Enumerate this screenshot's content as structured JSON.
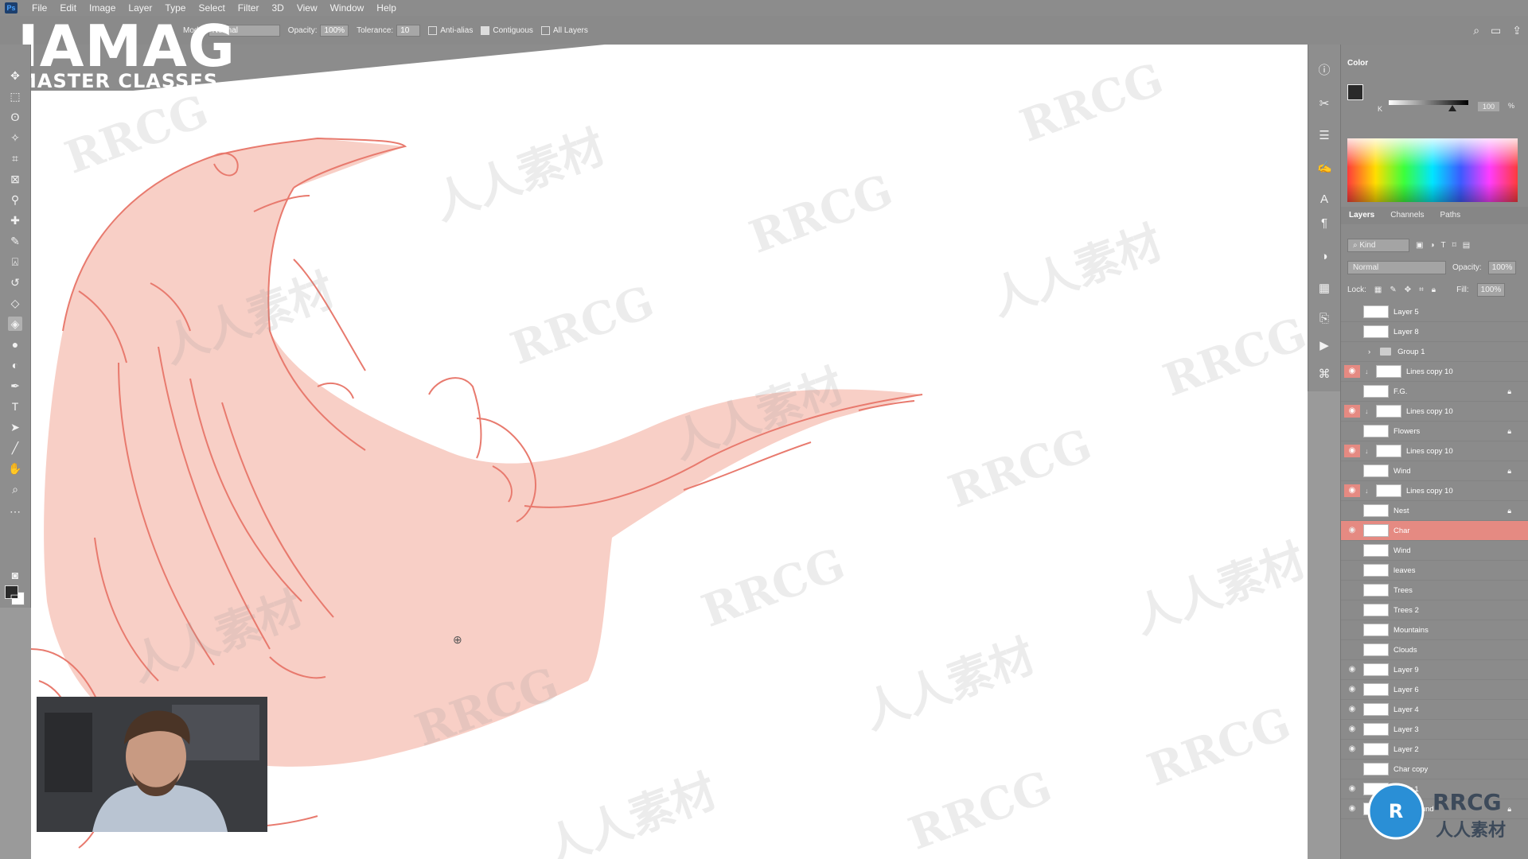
{
  "menu": [
    "File",
    "Edit",
    "Image",
    "Layer",
    "Type",
    "Select",
    "Filter",
    "3D",
    "View",
    "Window",
    "Help"
  ],
  "options": {
    "mode_label": "Mode:",
    "mode_value": "Normal",
    "opacity_label": "Opacity:",
    "opacity_value": "100%",
    "tolerance_label": "Tolerance:",
    "tolerance_value": "10",
    "anti_alias": "Anti-alias",
    "contiguous": "Contiguous",
    "all_layers": "All Layers"
  },
  "brand": {
    "main": "IAMAG",
    "sub": "MASTER CLASSES"
  },
  "watermark": {
    "text1": "RRCG",
    "text2": "人人素材"
  },
  "color_panel": {
    "title": "Color",
    "k_label": "K",
    "k_value": "100",
    "k_fraction": 0.8,
    "percent": "%"
  },
  "layers_panel": {
    "tabs": [
      "Layers",
      "Channels",
      "Paths"
    ],
    "kind": "Kind",
    "blend": "Normal",
    "opacity_label": "Opacity:",
    "opacity_value": "100%",
    "lock_label": "Lock:",
    "fill_label": "Fill:",
    "fill_value": "100%",
    "layers": [
      {
        "name": "Layer 5",
        "eye": false
      },
      {
        "name": "Layer 8",
        "eye": false
      },
      {
        "name": "Group 1",
        "eye": false,
        "group": true
      },
      {
        "name": "Lines copy 10",
        "eye": "red",
        "clip": true
      },
      {
        "name": "F.G.",
        "eye": false,
        "locked": true
      },
      {
        "name": "Lines copy 10",
        "eye": "red",
        "clip": true
      },
      {
        "name": "Flowers",
        "eye": false,
        "locked": true
      },
      {
        "name": "Lines copy 10",
        "eye": "red",
        "clip": true
      },
      {
        "name": "Wind",
        "eye": false,
        "locked": true
      },
      {
        "name": "Lines copy 10",
        "eye": "red",
        "clip": true
      },
      {
        "name": "Nest",
        "eye": false,
        "locked": true
      },
      {
        "name": "Char",
        "eye": true,
        "selected": true
      },
      {
        "name": "Wind",
        "eye": false
      },
      {
        "name": "leaves",
        "eye": false
      },
      {
        "name": "Trees",
        "eye": false
      },
      {
        "name": "Trees 2",
        "eye": false
      },
      {
        "name": "Mountains",
        "eye": false
      },
      {
        "name": "Clouds",
        "eye": false
      },
      {
        "name": "Layer 9",
        "eye": true
      },
      {
        "name": "Layer 6",
        "eye": true
      },
      {
        "name": "Layer 4",
        "eye": true
      },
      {
        "name": "Layer 3",
        "eye": true
      },
      {
        "name": "Layer 2",
        "eye": true
      },
      {
        "name": "Char copy",
        "eye": false
      },
      {
        "name": "Layer 1",
        "eye": true
      },
      {
        "name": "Background",
        "eye": true,
        "locked": true
      }
    ]
  },
  "logo": {
    "text1": "RRCG",
    "text2": "人人素材"
  },
  "colors": {
    "accent": "#e58a82",
    "sketch": "#e87a6e",
    "fill": "#f8cfc6"
  }
}
